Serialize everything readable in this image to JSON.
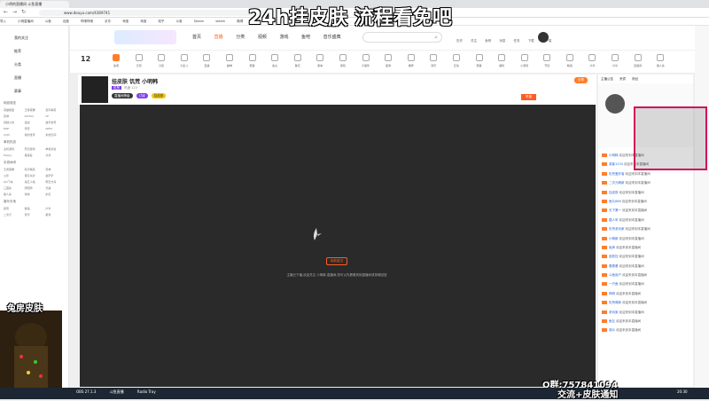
{
  "overlay": {
    "title": "24h挂皮肤 流程看免吧",
    "qq": "Q群:757841094",
    "notice": "交流+皮肤通知",
    "skin_label": "兔房皮肤"
  },
  "browser": {
    "tab_title": "小明的直播间 斗鱼直播",
    "url": "www.douyu.com/4369741",
    "bookmarks": [
      "导入",
      "小明直播间",
      "斗鱼",
      "百度",
      "哔哩哔哩",
      "京东",
      "淘宝",
      "淘宝",
      "知乎",
      "斗鱼",
      "Steam",
      "steam",
      "微博",
      "网易",
      "淘宝",
      "工具"
    ]
  },
  "sidebar": {
    "items": [
      "我的关注",
      "推荐",
      "分类",
      "直播",
      "赛事"
    ],
    "groups": [
      {
        "title": "网游竞技",
        "cells": [
          "英雄联盟",
          "王者荣耀",
          "和平精英",
          "原神",
          "DOTA2",
          "CF",
          "穿越火线",
          "逆战",
          "魔兽世界",
          "DNF",
          "传奇",
          "APEX",
          "COD",
          "我的世界",
          "永劫无间"
        ]
      },
      {
        "title": "单机热游",
        "cells": [
          "主机游戏",
          "怀旧游戏",
          "单机综合",
          "Poppy",
          "星露谷",
          "方舟"
        ]
      },
      {
        "title": "手游休闲",
        "cells": [
          "王者荣耀",
          "和平精英",
          "原神",
          "火影",
          "蛋仔派对",
          "金铲铲",
          "QQ飞车",
          "第五人格",
          "明日方舟",
          "三国杀",
          "阴阳师",
          "光遇",
          "狼人杀",
          "球球",
          "炉石"
        ]
      },
      {
        "title": "娱乐天地",
        "cells": [
          "颜值",
          "舞蹈",
          "户外",
          "二次元",
          "音乐",
          "星秀"
        ]
      }
    ]
  },
  "topnav": {
    "links": [
      "首页",
      "直播",
      "分类",
      "视频",
      "游戏",
      "鱼吧",
      "音乐盛典"
    ],
    "right": [
      "历史",
      "关注",
      "鱼吧",
      "消息",
      "任务",
      "下载",
      "客户端"
    ]
  },
  "categories": [
    "12",
    "鱼塘",
    "订阅",
    "分区",
    "大乱斗",
    "直播",
    "超神",
    "赛事",
    "鱼丸",
    "聊天",
    "剧本",
    "游戏",
    "大事件",
    "星秀",
    "推荐",
    "音乐",
    "互动",
    "赛事",
    "福利",
    "小游戏",
    "节目",
    "精选",
    "户外",
    "分享",
    "直播间",
    "狼人杀",
    "开播",
    "商城",
    "日报",
    "王牌"
  ],
  "room": {
    "name": "挂皮肤 饥荒 小明韩",
    "tags": [
      "饥荒",
      "挂皮肤"
    ],
    "sub": "热度 123",
    "share": "分享",
    "report": "举报",
    "fans": "订阅",
    "badge": "直播间等级"
  },
  "player": {
    "status_btn": "刷新重试",
    "message": "主播已下播,欢迎关注 小明韩 直播间,您可以先看看其他直播间或录像回放"
  },
  "chat": {
    "tabs": [
      "主播公告",
      "贵宾",
      "粉丝"
    ],
    "lines": [
      {
        "name": "小明韩",
        "text": "欢迎来到本直播间"
      },
      {
        "name": "游客1234",
        "text": "欢迎来到本直播间"
      },
      {
        "name": "饥荒爱好者",
        "text": "欢迎来到本直播间"
      },
      {
        "name": "二次元萌新",
        "text": "欢迎来到本直播间"
      },
      {
        "name": "挂皮肤",
        "text": "欢迎来到本直播间"
      },
      {
        "name": "鱼丸666",
        "text": "欢迎来到本直播间"
      },
      {
        "name": "天下第一",
        "text": "欢迎来到本直播间"
      },
      {
        "name": "路人甲",
        "text": "欢迎来到本直播间"
      },
      {
        "name": "饥荒老玩家",
        "text": "欢迎来到本直播间"
      },
      {
        "name": "小萌新",
        "text": "欢迎来到本直播间"
      },
      {
        "name": "兔房",
        "text": "欢迎来到本直播间"
      },
      {
        "name": "皮肤控",
        "text": "欢迎来到本直播间"
      },
      {
        "name": "看看看",
        "text": "欢迎来到本直播间"
      },
      {
        "name": "斗鱼用户",
        "text": "欢迎来到本直播间"
      },
      {
        "name": "一只鱼",
        "text": "欢迎来到本直播间"
      },
      {
        "name": "明明",
        "text": "欢迎来到本直播间"
      },
      {
        "name": "饥荒萌新",
        "text": "欢迎来到本直播间"
      },
      {
        "name": "老玩家",
        "text": "欢迎来到本直播间"
      },
      {
        "name": "鱼友",
        "text": "欢迎来到本直播间"
      },
      {
        "name": "观众",
        "text": "欢迎来到本直播间"
      }
    ]
  },
  "taskbar": {
    "apps": [
      "OBS 27.1.3",
      "斗鱼直播",
      "Radio Tray"
    ],
    "clock": "20:30"
  },
  "colors": {
    "accent": "#ff7d2a",
    "frame": "#d00d5a",
    "overlay_text": "#ffffff"
  }
}
